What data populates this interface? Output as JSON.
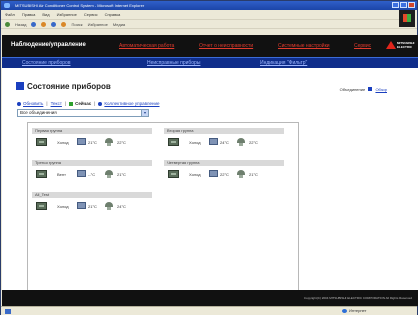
{
  "window": {
    "title": "MITSUBISHI Air Conditioner Control System - Microsoft Internet Explorer"
  },
  "browser": {
    "menu": [
      "Файл",
      "Правка",
      "Вид",
      "Избранное",
      "Сервис",
      "Справка"
    ],
    "toolbar": [
      "Назад",
      "Поиск",
      "Избранное",
      "Медиа"
    ],
    "address": ""
  },
  "navbar": {
    "main": "Наблюдение/управление",
    "links": [
      "Автоматическая работа",
      "Отчет о неисправности",
      "Системные настройки",
      "Сервис"
    ],
    "logo_text": [
      "MITSUBISHI",
      "ELECTRIC"
    ]
  },
  "subnav": {
    "links": [
      "Состояние приборов",
      "Неисправные приборы",
      "Индикация \"Фильтр\""
    ]
  },
  "page": {
    "title": "Состояние приборов",
    "overview_label": "Объединение",
    "overview_link": "Обзор",
    "actions": {
      "refresh": "Обновить",
      "sort": "Текст",
      "now": "Сейчас",
      "collective": "Коллективное управление"
    },
    "group_select": "Все объединения"
  },
  "groups": [
    {
      "name": "Первая группа",
      "mode": "Холод",
      "set_temp": "21°C",
      "room_temp": "22°C"
    },
    {
      "name": "Вторая группа",
      "mode": "Холод",
      "set_temp": "24°C",
      "room_temp": "22°C"
    },
    {
      "name": "Третья группа",
      "mode": "Вент",
      "set_temp": "--°C",
      "room_temp": "21°C"
    },
    {
      "name": "Четвертая группа",
      "mode": "Холод",
      "set_temp": "22°C",
      "room_temp": "21°C"
    },
    {
      "name": "All_Test",
      "mode": "Холод",
      "set_temp": "21°C",
      "room_temp": "24°C"
    }
  ],
  "footer": {
    "copyright": "Copyright(C) 2004 MITSUBISHI ELECTRIC CORPORATION All Rights Reserved"
  },
  "statusbar": {
    "zone": "Интернет"
  }
}
